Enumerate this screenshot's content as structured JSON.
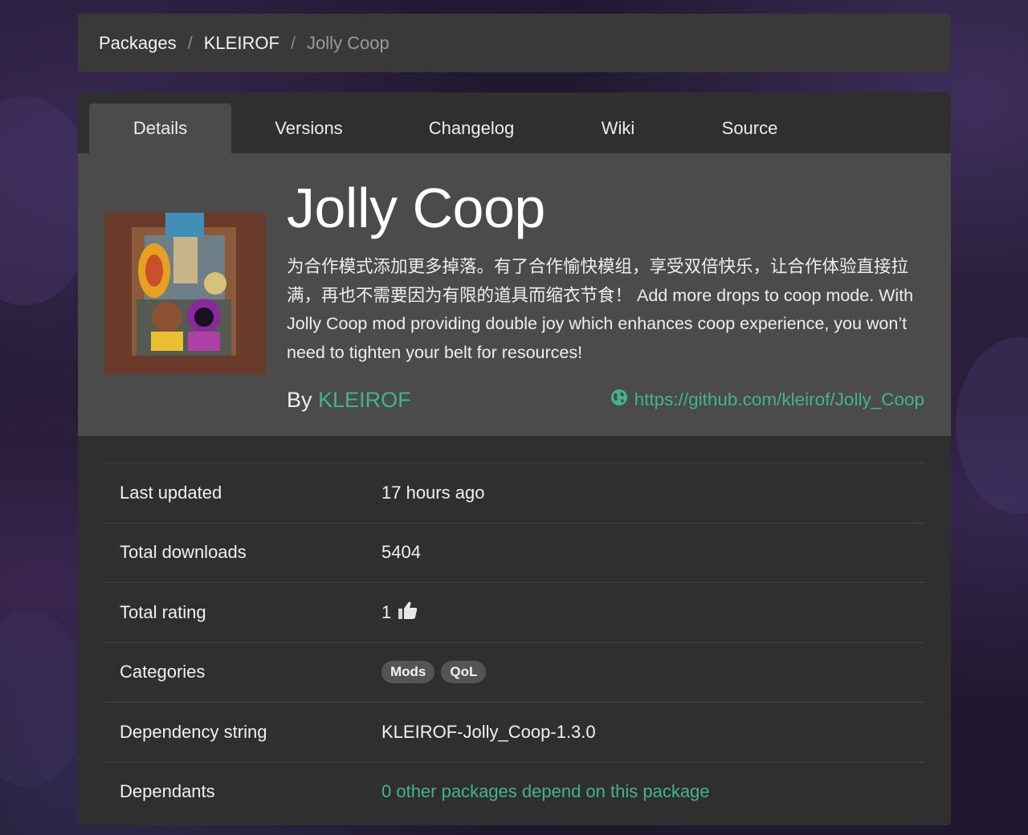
{
  "breadcrumb": {
    "root": "Packages",
    "owner": "KLEIROF",
    "current": "Jolly Coop",
    "separator": "/"
  },
  "tabs": [
    {
      "label": "Details",
      "active": true
    },
    {
      "label": "Versions",
      "active": false
    },
    {
      "label": "Changelog",
      "active": false
    },
    {
      "label": "Wiki",
      "active": false
    },
    {
      "label": "Source",
      "active": false
    }
  ],
  "package": {
    "title": "Jolly Coop",
    "description": "为合作模式添加更多掉落。有了合作愉快模组，享受双倍快乐，让合作体验直接拉满，再也不需要因为有限的道具而缩衣节食！ Add more drops to coop mode. With Jolly Coop mod providing double joy which enhances coop experience, you won’t need to tighten your belt for resources!",
    "by_prefix": "By",
    "author": "KLEIROF",
    "website": "https://github.com/kleirof/Jolly_Coop",
    "website_icon": "globe-icon"
  },
  "details": {
    "last_updated_label": "Last updated",
    "last_updated": "17 hours ago",
    "downloads_label": "Total downloads",
    "downloads": "5404",
    "rating_label": "Total rating",
    "rating": "1",
    "rating_icon": "thumbs-up-icon",
    "categories_label": "Categories",
    "categories": [
      "Mods",
      "QoL"
    ],
    "dependency_label": "Dependency string",
    "dependency": "KLEIROF-Jolly_Coop-1.3.0",
    "dependants_label": "Dependants",
    "dependants": "0 other packages depend on this package"
  },
  "colors": {
    "accent": "#42b48d",
    "panel": "#2f2f2f",
    "hero": "#4b4b4b"
  }
}
